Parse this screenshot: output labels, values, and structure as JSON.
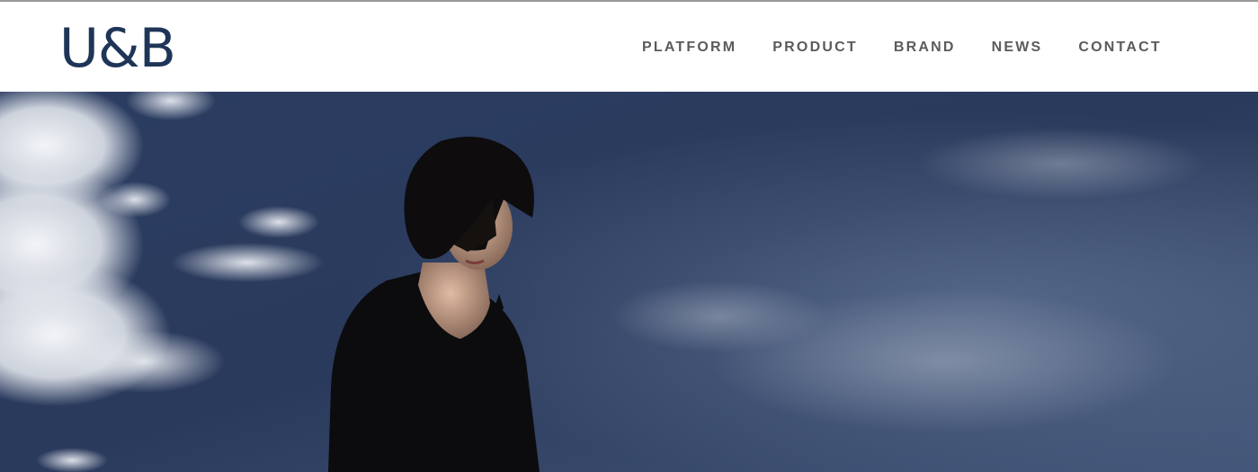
{
  "brand": {
    "logo_text": "U&B",
    "logo_color": "#1e3557"
  },
  "nav": {
    "items": [
      {
        "label": "PLATFORM"
      },
      {
        "label": "PRODUCT"
      },
      {
        "label": "BRAND"
      },
      {
        "label": "NEWS"
      },
      {
        "label": "CONTACT"
      }
    ],
    "text_color": "#5b5b5b"
  },
  "hero": {
    "sky_color": "#2e4166",
    "cloud_color": "#dfe3ea",
    "figure_color": "#0c0c0e",
    "skin_color": "#c9a48e"
  }
}
